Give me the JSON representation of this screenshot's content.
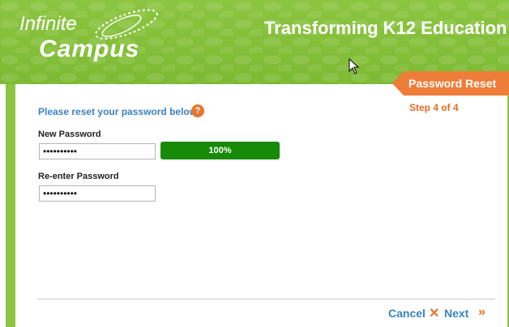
{
  "header": {
    "logo_line1": "Infinite",
    "logo_line2": "Campus",
    "tagline": "Transforming K12 Education"
  },
  "step_ribbon": {
    "title": "Password Reset",
    "step": "Step 4 of 4"
  },
  "form": {
    "instruction": "Please reset your password below",
    "help_symbol": "?",
    "new_password_label": "New Password",
    "new_password_value": "••••••••••",
    "strength_text": "100%",
    "strength_value": 1.0,
    "reenter_password_label": "Re-enter Password",
    "reenter_password_value": "••••••••••"
  },
  "footer": {
    "cancel_label": "Cancel",
    "cancel_icon": "x-icon",
    "next_label": "Next",
    "next_icon": "double-chevron-right-icon"
  },
  "colors": {
    "brand_green": "#8cc541",
    "accent_orange": "#ef7d3a",
    "link_blue": "#3b82c4",
    "strength_green": "#178a08"
  }
}
